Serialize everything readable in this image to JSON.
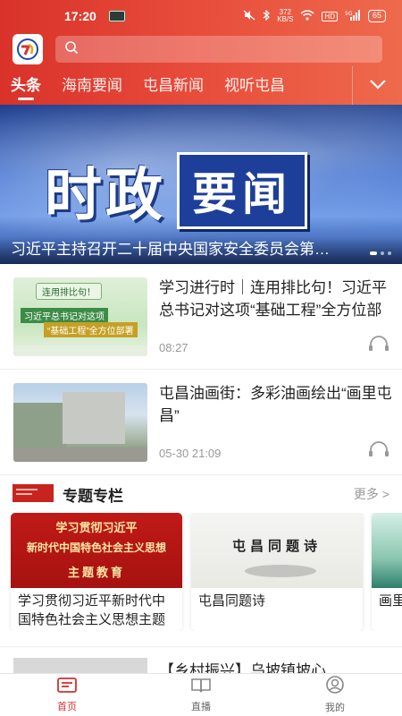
{
  "status_bar": {
    "time": "17:20",
    "speed": "372\nKB/S",
    "network": "HD",
    "signal": "5G",
    "battery": "65"
  },
  "search": {
    "placeholder": ""
  },
  "tabs": [
    {
      "label": "头条",
      "active": true
    },
    {
      "label": "海南要闻",
      "active": false
    },
    {
      "label": "屯昌新闻",
      "active": false
    },
    {
      "label": "视听屯昌",
      "active": false
    }
  ],
  "banner": {
    "title_left": "时政",
    "title_right": "要闻",
    "caption": "习近平主持召开二十届中央国家安全委员会第一次会议",
    "slides": 3,
    "active_slide": 0
  },
  "news": [
    {
      "title": "学习进行时｜连用排比句！习近平总书记对这项“基础工程”全方位部署",
      "time": "08:27",
      "thumb": {
        "label_a": "连用排比句！",
        "label_b": "习近平总书记对这项",
        "label_c": "“基础工程”全方位部署"
      }
    },
    {
      "title": "屯昌油画街：多彩油画绘出“画里屯昌”",
      "time": "05-30 21:09"
    }
  ],
  "special": {
    "title": "专题专栏",
    "more": "更多 >",
    "cards": [
      {
        "title": "学习贯彻习近平新时代中国特色社会主义思想主题教育",
        "img_line1": "学习贯彻习近平",
        "img_line2": "新时代中国特色社会主义思想",
        "img_line3": "主题教育"
      },
      {
        "title": "屯昌同题诗",
        "img_text": "屯昌同题诗"
      },
      {
        "title": "画里屯昌"
      }
    ]
  },
  "news_partial": {
    "title": "【乡村振兴】乌坡镇坡心"
  },
  "bottom_nav": [
    {
      "label": "首页",
      "active": true
    },
    {
      "label": "直播",
      "active": false
    },
    {
      "label": "我的",
      "active": false
    }
  ],
  "colors": {
    "brand_red": "#d9322a",
    "accent": "#d32f2f"
  }
}
